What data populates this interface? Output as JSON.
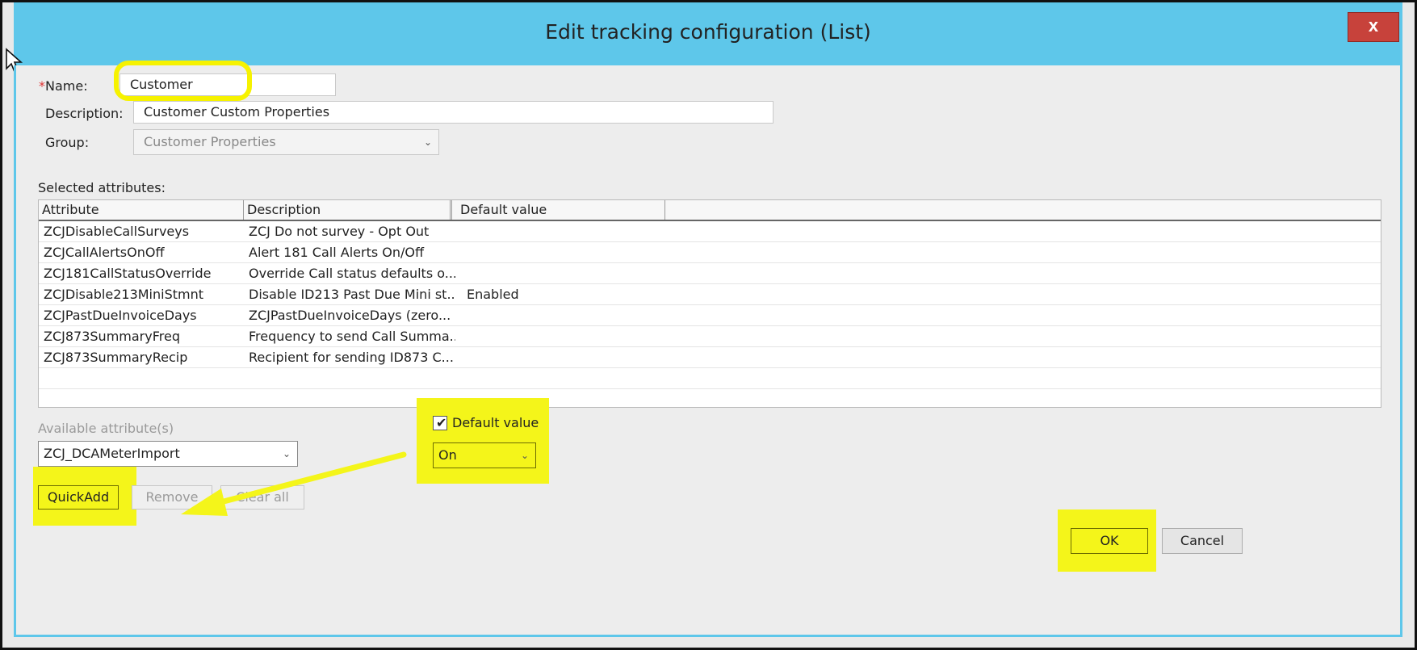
{
  "window": {
    "title": "Edit tracking configuration (List)",
    "close_label": "x"
  },
  "form": {
    "name_required_mark": "*",
    "name_label": "Name:",
    "name_value": "Customer",
    "description_label": "Description:",
    "description_value": "Customer Custom Properties",
    "group_label": "Group:",
    "group_value": "Customer Properties"
  },
  "selected": {
    "label": "Selected attributes:",
    "columns": [
      "Attribute",
      "Description",
      "Default value"
    ],
    "rows": [
      {
        "attribute": "ZCJDisableCallSurveys",
        "description": "ZCJ Do not survey - Opt Out",
        "default": ""
      },
      {
        "attribute": "ZCJCallAlertsOnOff",
        "description": "Alert 181 Call Alerts On/Off",
        "default": ""
      },
      {
        "attribute": "ZCJ181CallStatusOverride",
        "description": "Override Call status defaults o...",
        "default": ""
      },
      {
        "attribute": "ZCJDisable213MiniStmnt",
        "description": "Disable ID213 Past Due Mini st...",
        "default": "Enabled"
      },
      {
        "attribute": "ZCJPastDueInvoiceDays",
        "description": "ZCJPastDueInvoiceDays (zero...",
        "default": ""
      },
      {
        "attribute": "ZCJ873SummaryFreq",
        "description": "Frequency to send Call Summa...",
        "default": ""
      },
      {
        "attribute": "ZCJ873SummaryRecip",
        "description": "Recipient for sending ID873 C...",
        "default": ""
      }
    ]
  },
  "available": {
    "label": "Available attribute(s)",
    "value": "ZCJ_DCAMeterImport"
  },
  "default_value": {
    "checkbox_label": "Default value",
    "checked": true,
    "select_value": "On"
  },
  "buttons": {
    "quickadd": "QuickAdd",
    "remove": "Remove",
    "clear_all": "Clear all",
    "ok": "OK",
    "cancel": "Cancel"
  },
  "colors": {
    "titlebar": "#5ec7ea",
    "highlight": "#f4f51a",
    "close": "#c7423b"
  }
}
